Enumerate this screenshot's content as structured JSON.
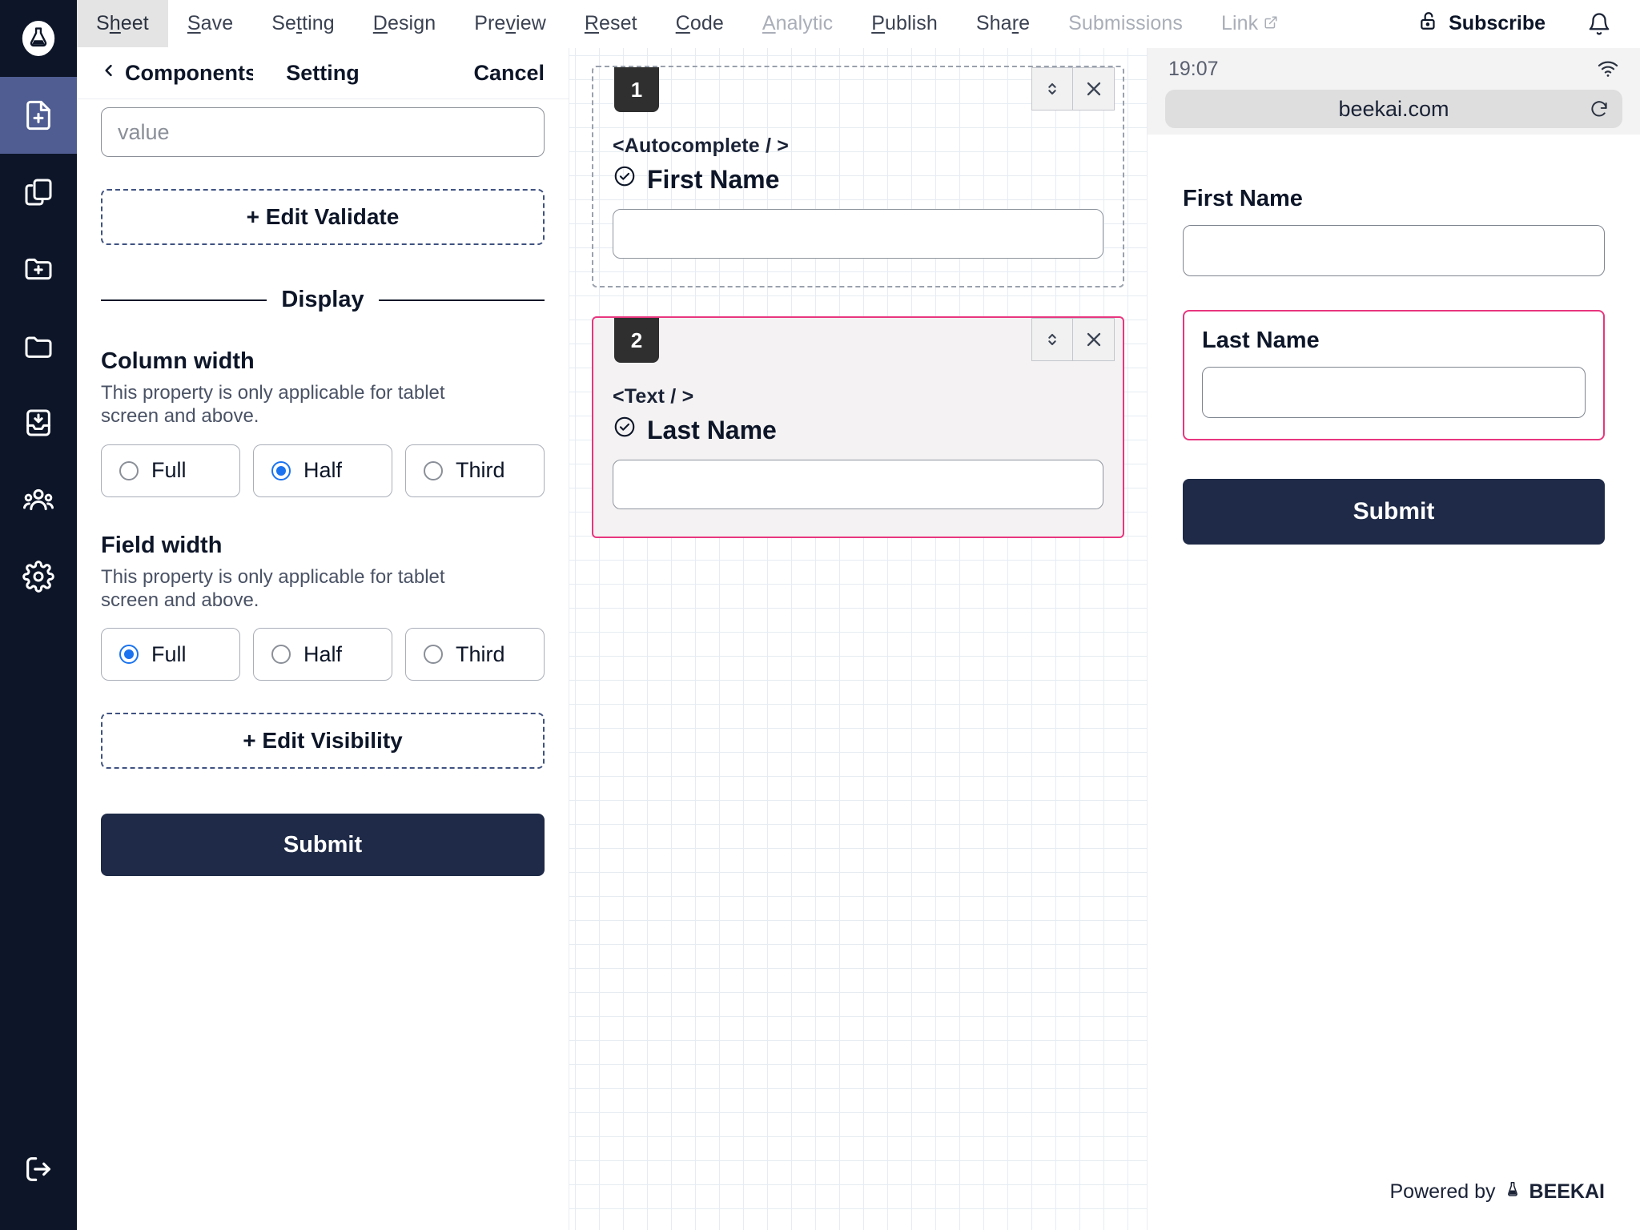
{
  "rail": {
    "logo_icon": "beekai-flask-logo",
    "items": [
      {
        "icon": "file-plus-icon",
        "name": "new-form",
        "active": true
      },
      {
        "icon": "copy-icon",
        "name": "duplicate-form",
        "active": false
      },
      {
        "icon": "folder-plus-icon",
        "name": "new-folder",
        "active": false
      },
      {
        "icon": "folder-icon",
        "name": "folders",
        "active": false
      },
      {
        "icon": "inbox-download-icon",
        "name": "inbox",
        "active": false
      },
      {
        "icon": "users-icon",
        "name": "team",
        "active": false
      },
      {
        "icon": "gear-icon",
        "name": "settings",
        "active": false
      }
    ],
    "logout_icon": "logout-icon"
  },
  "topnav": {
    "items": [
      {
        "label": "Sheet",
        "accel": "h",
        "state": "active"
      },
      {
        "label": "Save",
        "accel": "S",
        "state": "normal"
      },
      {
        "label": "Setting",
        "accel": "t",
        "state": "normal"
      },
      {
        "label": "Design",
        "accel": "D",
        "state": "normal"
      },
      {
        "label": "Preview",
        "accel": "v",
        "state": "normal"
      },
      {
        "label": "Reset",
        "accel": "R",
        "state": "normal"
      },
      {
        "label": "Code",
        "accel": "C",
        "state": "normal"
      },
      {
        "label": "Analytic",
        "accel": "A",
        "state": "muted"
      },
      {
        "label": "Publish",
        "accel": "P",
        "state": "normal"
      },
      {
        "label": "Share",
        "accel": "r",
        "state": "normal"
      },
      {
        "label": "Submissions",
        "accel": "",
        "state": "muted"
      },
      {
        "label": "Link",
        "accel": "",
        "state": "muted",
        "external": true
      }
    ],
    "subscribe_label": "Subscribe",
    "subscribe_icon": "unlock-icon",
    "bell_icon": "bell-icon",
    "external_icon": "external-link-icon"
  },
  "panel": {
    "back_label": "Components",
    "back_icon": "chevron-left-icon",
    "title": "Setting",
    "cancel_label": "Cancel",
    "value_field": {
      "placeholder": "value",
      "value": ""
    },
    "edit_validate_label": "+ Edit Validate",
    "display_divider_label": "Display",
    "column_width": {
      "title": "Column width",
      "description": "This property is only applicable for tablet screen and above.",
      "options": [
        "Full",
        "Half",
        "Third"
      ],
      "selected": "Half"
    },
    "field_width": {
      "title": "Field width",
      "description": "This property is only applicable for tablet screen and above.",
      "options": [
        "Full",
        "Half",
        "Third"
      ],
      "selected": "Full"
    },
    "edit_visibility_label": "+ Edit Visibility",
    "submit_label": "Submit"
  },
  "canvas": {
    "cards": [
      {
        "number": "1",
        "tag": "<Autocomplete / >",
        "label": "First Name",
        "check_icon": "circle-check-icon",
        "input_value": "",
        "selected": false,
        "reorder_icon": "chevron-up-down-icon",
        "remove_icon": "close-icon"
      },
      {
        "number": "2",
        "tag": "<Text / >",
        "label": "Last Name",
        "check_icon": "circle-check-icon",
        "input_value": "",
        "selected": true,
        "reorder_icon": "chevron-up-down-icon",
        "remove_icon": "close-icon"
      }
    ]
  },
  "preview": {
    "status_time": "19:07",
    "wifi_icon": "wifi-icon",
    "url": "beekai.com",
    "reload_icon": "reload-icon",
    "fields": [
      {
        "label": "First Name",
        "value": "",
        "selected": false
      },
      {
        "label": "Last Name",
        "value": "",
        "selected": true
      }
    ],
    "submit_label": "Submit",
    "footer_prefix": "Powered by",
    "footer_brand": "BEEKAI",
    "footer_icon": "beekai-flask-logo"
  },
  "colors": {
    "rail_bg": "#0d1628",
    "rail_active": "#4f5d92",
    "accent_pink": "#e8367f",
    "accent_blue": "#1a73f0",
    "dark_navy": "#1e2a47",
    "grid_line": "#e6ecf2"
  }
}
